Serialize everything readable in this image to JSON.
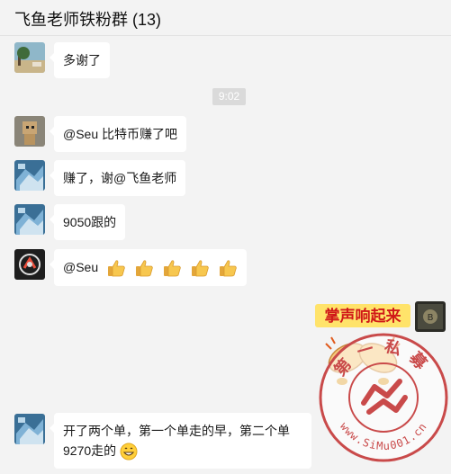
{
  "header": {
    "title": "飞鱼老师铁粉群 (13)"
  },
  "messages": [
    {
      "text": "多谢了"
    },
    {
      "text": "@Seu 比特币赚了吧"
    },
    {
      "text": "赚了，谢@飞鱼老师"
    },
    {
      "text": "9050跟的"
    },
    {
      "text": "@Seu"
    },
    {
      "text": "开了两个单，第一个单走的早，第二个单9270走的"
    }
  ],
  "time_divider": "9:02",
  "sticker_text": "掌声响起来",
  "stamp": {
    "upper": "第一私募",
    "lower": "www.SiMu001.cn"
  },
  "colors": {
    "background": "#f3f3f3",
    "bubble": "#ffffff",
    "divider": "#dadada"
  }
}
